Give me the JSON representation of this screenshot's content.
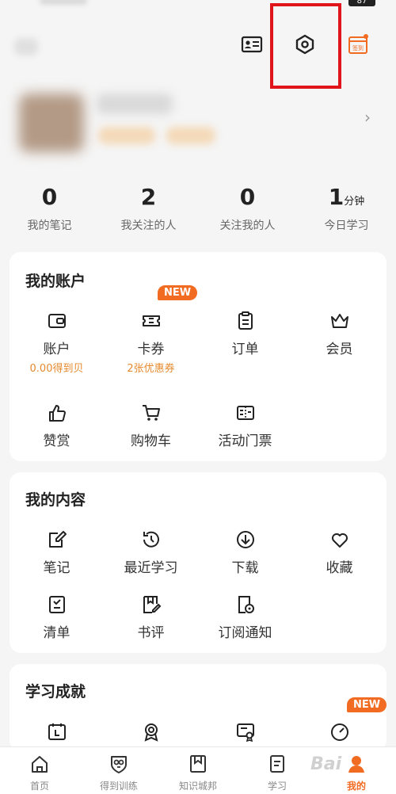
{
  "status": {
    "battery": "87"
  },
  "header": {
    "card_icon": "id-card-icon",
    "settings_icon": "settings-hexagon-icon",
    "checkin_label": "签到",
    "colors": {
      "highlight": "#e0141b",
      "accent": "#f26b22"
    }
  },
  "profile": {
    "arrow": "›"
  },
  "stats": [
    {
      "value": "0",
      "unit": "",
      "label": "我的笔记"
    },
    {
      "value": "2",
      "unit": "",
      "label": "我关注的人"
    },
    {
      "value": "0",
      "unit": "",
      "label": "关注我的人"
    },
    {
      "value": "1",
      "unit": "分钟",
      "label": "今日学习"
    }
  ],
  "account": {
    "title": "我的账户",
    "new_badge": "NEW",
    "items": [
      {
        "label": "账户",
        "sub": "0.00得到贝",
        "icon": "wallet-icon"
      },
      {
        "label": "卡券",
        "sub": "2张优惠券",
        "icon": "ticket-icon"
      },
      {
        "label": "订单",
        "sub": "",
        "icon": "clipboard-icon"
      },
      {
        "label": "会员",
        "sub": "",
        "icon": "crown-icon"
      },
      {
        "label": "赞赏",
        "sub": "",
        "icon": "thumbs-up-icon"
      },
      {
        "label": "购物车",
        "sub": "",
        "icon": "cart-icon"
      },
      {
        "label": "活动门票",
        "sub": "",
        "icon": "event-ticket-icon"
      }
    ]
  },
  "content": {
    "title": "我的内容",
    "items": [
      {
        "label": "笔记",
        "icon": "note-edit-icon"
      },
      {
        "label": "最近学习",
        "icon": "history-icon"
      },
      {
        "label": "下载",
        "icon": "download-icon"
      },
      {
        "label": "收藏",
        "icon": "heart-icon"
      },
      {
        "label": "清单",
        "icon": "checklist-icon"
      },
      {
        "label": "书评",
        "icon": "book-review-icon"
      },
      {
        "label": "订阅通知",
        "icon": "subscription-notice-icon"
      }
    ]
  },
  "achievements": {
    "title": "学习成就",
    "new_badge": "NEW",
    "icons": [
      "calendar-icon",
      "medal-icon",
      "certificate-icon",
      "gauge-icon"
    ]
  },
  "tabs": [
    {
      "label": "首页",
      "icon": "home-icon",
      "active": false
    },
    {
      "label": "得到训练",
      "icon": "owl-shield-icon",
      "active": false
    },
    {
      "label": "知识城邦",
      "icon": "bookmark-icon",
      "active": false
    },
    {
      "label": "学习",
      "icon": "study-icon",
      "active": false
    },
    {
      "label": "我的",
      "icon": "profile-icon",
      "active": true
    }
  ],
  "watermark": "Bai"
}
